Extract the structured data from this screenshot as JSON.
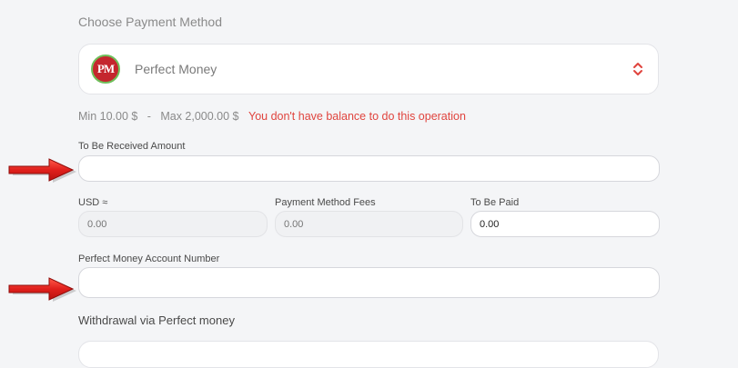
{
  "payment": {
    "section_title": "Choose Payment Method",
    "method_name": "Perfect Money",
    "logo_text": "PM",
    "min_label": "Min 10.00 $",
    "dash": "-",
    "max_label": "Max 2,000.00 $",
    "warning": "You don't have balance to do this operation"
  },
  "form": {
    "received_label": "To Be Received Amount",
    "received_value": "",
    "usd_label": "USD ≈",
    "usd_placeholder": "0.00",
    "fees_label": "Payment Method Fees",
    "fees_placeholder": "0.00",
    "paid_label": "To Be Paid",
    "paid_value": "0.00",
    "account_label": "Perfect Money Account Number",
    "account_value": "",
    "withdrawal_label": "Withdrawal via Perfect money"
  },
  "colors": {
    "warning": "#e0443e",
    "arrow": "#e0201c",
    "logo_red": "#c4262e",
    "logo_ring": "#6fbf5b"
  }
}
